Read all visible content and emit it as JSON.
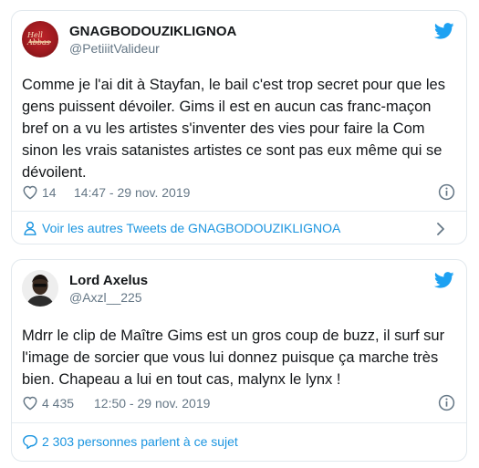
{
  "tweets": [
    {
      "author_name": "GNAGBODOUZIKLIGNOA",
      "author_handle": "@PetiiitValideur",
      "avatar_text": "Hell Abbas",
      "text": "Comme je l'ai dit à Stayfan, le bail c'est trop secret pour que les\ngens puissent dévoiler. Gims il est en aucun cas franc-maçon\nbref on a vu les artistes s'inventer des vies pour faire la Com\nsinon les vrais satanistes artistes ce sont pas eux même qui se\ndévoilent.",
      "likes": "14",
      "time": "14:47 - 29 nov. 2019",
      "footer_label": "Voir les autres Tweets de GNAGBODOUZIKLIGNOA",
      "footer_icon": "person-icon"
    },
    {
      "author_name": "Lord Axelus",
      "author_handle": "@Axzl__225",
      "text": "Mdrr le clip de Maître Gims est un gros coup de buzz, il surf sur\nl'image de sorcier que vous lui donnez puisque ça marche très\nbien. Chapeau a lui en tout cas, malynx le lynx !",
      "likes": "4 435",
      "time": "12:50 - 29 nov. 2019",
      "footer_label": "2 303 personnes parlent à ce sujet",
      "footer_icon": "comment-icon"
    }
  ],
  "colors": {
    "twitter_blue": "#1da1f2",
    "link_blue": "#1b95e0",
    "muted_gray": "#657786",
    "border": "#e1e8ed"
  }
}
